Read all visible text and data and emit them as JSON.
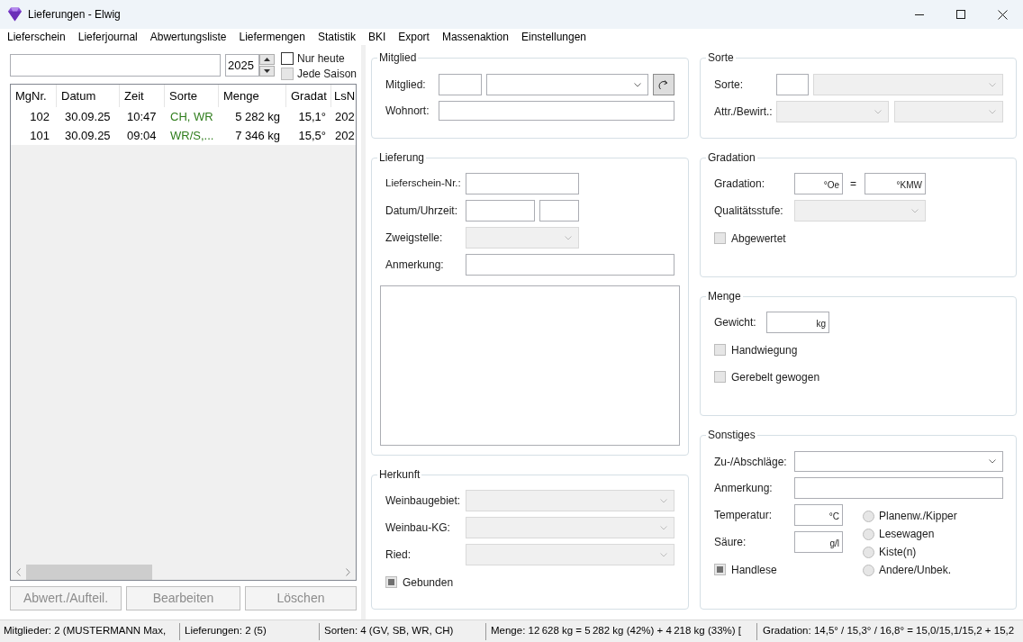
{
  "window": {
    "title": "Lieferungen - Elwig"
  },
  "menu": [
    "Lieferschein",
    "Lieferjournal",
    "Abwertungsliste",
    "Liefermengen",
    "Statistik",
    "BKI",
    "Export",
    "Massenaktion",
    "Einstellungen"
  ],
  "filter": {
    "year": "2025",
    "checkboxes": [
      {
        "label": "Nur heute",
        "checked": false,
        "indeterminate": false,
        "disabled": false
      },
      {
        "label": "Jede Saison",
        "checked": false,
        "indeterminate": false,
        "disabled": true
      }
    ]
  },
  "table": {
    "columns": [
      {
        "label": "MgNr.",
        "kind": "number"
      },
      {
        "label": "Datum",
        "kind": "text"
      },
      {
        "label": "Zeit",
        "kind": "text"
      },
      {
        "label": "Sorte",
        "kind": "variety"
      },
      {
        "label": "Menge",
        "kind": "number"
      },
      {
        "label": "Gradat",
        "kind": "number"
      },
      {
        "label": "LsN",
        "kind": "text"
      }
    ],
    "rows": [
      {
        "selected": false,
        "cells": [
          "102",
          "30.09.25",
          "10:47",
          "CH, WR",
          "5 282 kg",
          "15,1°",
          "202"
        ]
      },
      {
        "selected": false,
        "cells": [
          "101",
          "30.09.25",
          "09:04",
          "WR/S,...",
          "7 346 kg",
          "15,5°",
          "202"
        ]
      }
    ]
  },
  "list_buttons": [
    {
      "label": "Abwert./Aufteil.",
      "disabled": true
    },
    {
      "label": "Bearbeiten",
      "disabled": true
    },
    {
      "label": "Löschen",
      "disabled": true
    }
  ],
  "member": {
    "title": "Mitglied",
    "fields": [
      {
        "label": "Mitglied:",
        "disabled": false
      },
      {
        "label": "Wohnort:"
      }
    ]
  },
  "delivery": {
    "title": "Lieferung",
    "fields": [
      {
        "label": "Lieferschein-Nr.:"
      },
      {
        "label": "Datum/Uhrzeit:"
      },
      {
        "label": "Zweigstelle:",
        "disabled": true
      },
      {
        "label": "Anmerkung:"
      }
    ]
  },
  "origin": {
    "title": "Herkunft",
    "fields": [
      {
        "label": "Weinbaugebiet:",
        "disabled": true
      },
      {
        "label": "Weinbau-KG:",
        "disabled": true
      },
      {
        "label": "Ried:",
        "disabled": true
      }
    ],
    "checkbox": {
      "label": "Gebunden",
      "checked": false,
      "indeterminate": true,
      "disabled": true
    }
  },
  "variety": {
    "title": "Sorte",
    "fields": [
      {
        "label": "Sorte:",
        "disabled": true
      },
      {
        "label": "Attr./Bewirt.:",
        "dropdowns": [
          {
            "disabled": true
          },
          {
            "disabled": true
          }
        ]
      }
    ]
  },
  "gradation": {
    "title": "Gradation",
    "fields": [
      {
        "label": "Gradation:",
        "unit": "°Oe",
        "equals": "=",
        "unit_2": "°KMW"
      },
      {
        "label": "Qualitätsstufe:",
        "disabled": true
      }
    ],
    "checkbox": {
      "label": "Abgewertet",
      "checked": false,
      "indeterminate": false,
      "disabled": true
    }
  },
  "quantity": {
    "title": "Menge",
    "fields": [
      {
        "label": "Gewicht:",
        "unit": "kg"
      }
    ],
    "checkboxes": [
      {
        "label": "Handwiegung",
        "checked": false,
        "indeterminate": false,
        "disabled": true
      },
      {
        "label": "Gerebelt gewogen",
        "checked": false,
        "indeterminate": false,
        "disabled": true
      }
    ]
  },
  "other": {
    "title": "Sonstiges",
    "fields": [
      {
        "label": "Zu-/Abschläge:",
        "disabled": false
      },
      {
        "label": "Anmerkung:"
      },
      {
        "label": "Temperatur:",
        "unit": "°C"
      },
      {
        "label": "Säure:",
        "unit": "g/l"
      }
    ],
    "checkbox": {
      "label": "Handlese",
      "checked": false,
      "indeterminate": true,
      "disabled": true
    },
    "transport": [
      {
        "label": "Planenw./Kipper",
        "selected": false,
        "disabled": true
      },
      {
        "label": "Lesewagen",
        "selected": false,
        "disabled": true
      },
      {
        "label": "Kiste(n)",
        "selected": false,
        "disabled": true
      },
      {
        "label": "Andere/Unbek.",
        "selected": false,
        "disabled": true
      }
    ]
  },
  "status_bar": [
    "Mitglieder: 2 (MUSTERMANN Max,",
    "Lieferungen: 2 (5)",
    "Sorten: 4 (GV, SB, WR, CH)",
    "Menge: 12 628 kg = 5 282 kg (42%) + 4 218 kg (33%) [",
    "Gradation: 14,5° / 15,3° / 16,8° = 15,0/15,1/15,2 + 15,2"
  ]
}
